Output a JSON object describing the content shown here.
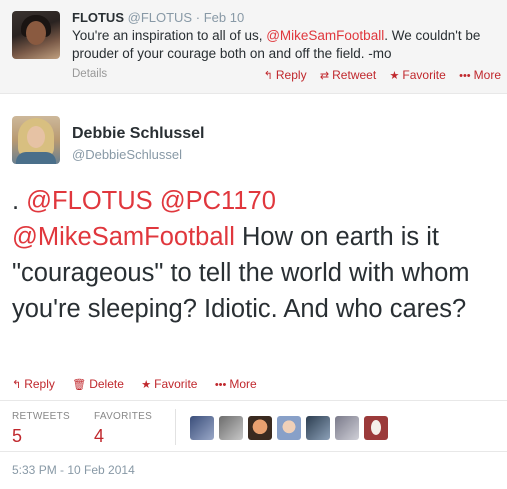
{
  "parent_tweet": {
    "name": "FLOTUS",
    "handle": "@FLOTUS",
    "separator": "·",
    "time": "Feb 10",
    "text_before": "You're an inspiration to all of us, ",
    "mention": "@MikeSamFootball",
    "text_after": ". We couldn't be prouder of your courage both on and off the field. -mo",
    "details_label": "Details",
    "actions": {
      "reply": "Reply",
      "retweet": "Retweet",
      "favorite": "Favorite",
      "more": "More"
    }
  },
  "main_tweet": {
    "name": "Debbie Schlussel",
    "handle": "@DebbieSchlussel",
    "text_lead": ". ",
    "mention_1": "@FLOTUS",
    "mention_2": "@PC1170",
    "mention_3": "@MikeSamFootball",
    "text_body": " How on earth is it \"courageous\" to tell the world with whom you're sleeping?  Idiotic.  And who cares?",
    "actions": {
      "reply": "Reply",
      "delete": "Delete",
      "favorite": "Favorite",
      "more": "More"
    },
    "stats": {
      "retweets_label": "RETWEETS",
      "retweets_count": "5",
      "favorites_label": "FAVORITES",
      "favorites_count": "4"
    },
    "timestamp": "5:33 PM - 10 Feb 2014"
  },
  "icons": {
    "reply": "reply-arrow-icon",
    "retweet": "retweet-icon",
    "favorite": "star-icon",
    "more": "ellipsis-icon",
    "delete": "trash-icon"
  },
  "colors": {
    "accent": "#c0282d",
    "mention": "#e0373d",
    "muted": "#8899a6",
    "parent_bg": "#f5f5f5"
  }
}
